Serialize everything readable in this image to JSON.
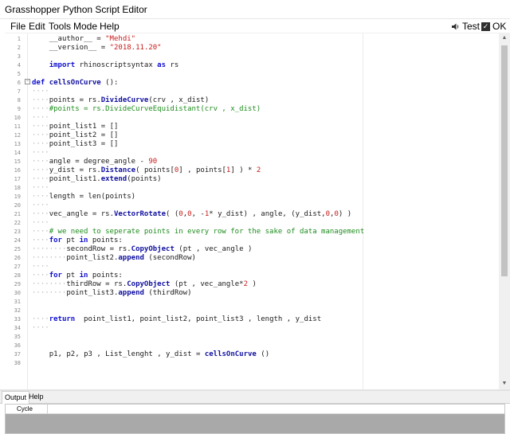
{
  "window": {
    "title": "Grasshopper Python Script Editor"
  },
  "menu": {
    "items": [
      "File",
      "Edit",
      "Tools",
      "Mode",
      "Help"
    ],
    "test_label": "Test",
    "ok_label": "OK"
  },
  "editor": {
    "lines": [
      "    __author__ = \"Mehdi\"",
      "    __version__ = \"2018.11.20\"",
      "",
      "    import rhinoscriptsyntax as rs",
      "",
      "def cellsOnCurve ():",
      "····",
      "····points = rs.DivideCurve(crv , x_dist)",
      "····#points = rs.DivideCurveEquidistant(crv , x_dist)",
      "····",
      "····point_list1 = []",
      "····point_list2 = []",
      "····point_list3 = []",
      "····",
      "····angle = degree_angle - 90",
      "····y_dist = rs.Distance( points[0] , points[1] ) * 2",
      "····point_list1.extend(points)",
      "····",
      "····length = len(points)",
      "····",
      "····vec_angle = rs.VectorRotate( (0,0, -1* y_dist) , angle, (y_dist,0,0) )",
      "····",
      "····# we need to seperate points in every row for the sake of data management",
      "····for pt in points:",
      "········secondRow = rs.CopyObject (pt , vec_angle )",
      "········point_list2.append (secondRow)",
      "····",
      "····for pt in points:",
      "········thirdRow = rs.CopyObject (pt , vec_angle*2 )",
      "········point_list3.append (thirdRow)",
      "",
      "",
      "····return  point_list1, point_list2, point_list3 , length , y_dist",
      "····",
      "",
      "",
      "    p1, p2, p3 , List_lenght , y_dist = cellsOnCurve ()",
      ""
    ]
  },
  "bottom": {
    "tabs": [
      "Output",
      "Help"
    ],
    "column_header": "Cycle"
  }
}
